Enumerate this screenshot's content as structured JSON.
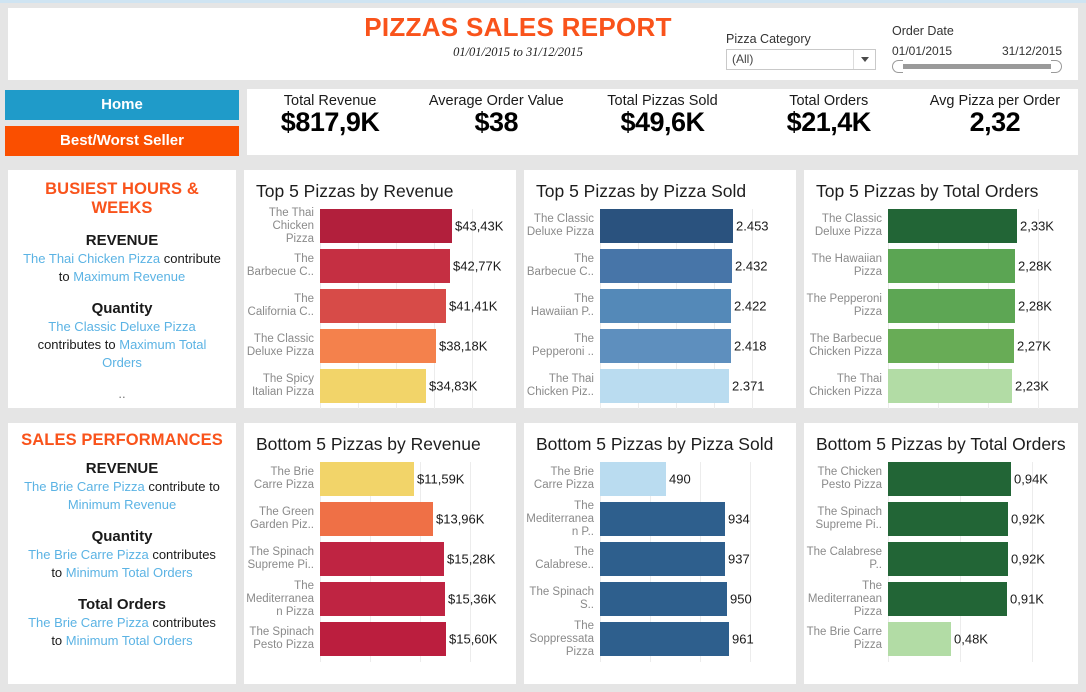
{
  "header": {
    "title": "PIZZAS SALES REPORT",
    "subtitle": "01/01/2015 to 31/12/2015",
    "category_label": "Pizza Category",
    "category_value": "(All)",
    "order_date_label": "Order Date",
    "date_start": "01/01/2015",
    "date_end": "31/12/2015"
  },
  "nav": {
    "home": "Home",
    "best_worst": "Best/Worst Seller",
    "home_color": "#1f9bc9",
    "best_color": "#fa4f00"
  },
  "kpis": [
    {
      "label": "Total Revenue",
      "value": "$817,9K"
    },
    {
      "label": "Average Order Value",
      "value": "$38"
    },
    {
      "label": "Total Pizzas Sold",
      "value": "$49,6K"
    },
    {
      "label": "Total Orders",
      "value": "$21,4K"
    },
    {
      "label": "Avg Pizza per Order",
      "value": "2,32"
    }
  ],
  "busiest": {
    "heading": "BUSIEST HOURS & WEEKS",
    "revenue_label": "REVENUE",
    "revenue_item": "The Thai Chicken Pizza",
    "revenue_mid": "contribute to ",
    "revenue_target": "Maximum Revenue",
    "quantity_label": "Quantity",
    "quantity_item": "The Classic Deluxe Pizza",
    "quantity_mid": "contributes to ",
    "quantity_target": "Maximum Total Orders",
    "dots": ".."
  },
  "sales": {
    "heading": "SALES PERFORMANCES",
    "revenue_label": "REVENUE",
    "revenue_item": "The Brie Carre Pizza",
    "revenue_mid": " contribute to ",
    "revenue_target": "Minimum Revenue",
    "quantity_label": "Quantity",
    "quantity_item": "The Brie Carre Pizza",
    "quantity_mid": " contributes to ",
    "quantity_target": "Minimum Total Orders",
    "orders_label": "Total Orders",
    "orders_item": "The Brie Carre Pizza",
    "orders_mid": " contributes to ",
    "orders_target": "Minimum Total Orders"
  },
  "chart_data": [
    {
      "id": "top_revenue",
      "type": "bar",
      "orientation": "horizontal",
      "title": "Top 5 Pizzas by Revenue",
      "xlabel": "",
      "ylabel": "",
      "grid": true,
      "xlim": [
        0,
        50000
      ],
      "categories": [
        "The Thai Chicken Pizza",
        "The Barbecue C..",
        "The California C..",
        "The Classic Deluxe Pizza",
        "The Spicy Italian Pizza"
      ],
      "values": [
        43430,
        42770,
        41410,
        38180,
        34830
      ],
      "labels": [
        "$43,43K",
        "$42,77K",
        "$41,41K",
        "$38,18K",
        "$34,83K"
      ],
      "colors": [
        "#b21f3c",
        "#c52f42",
        "#d74b48",
        "#f4814c",
        "#f2d469"
      ]
    },
    {
      "id": "top_sold",
      "type": "bar",
      "orientation": "horizontal",
      "title": "Top 5 Pizzas by  Pizza Sold",
      "xlabel": "",
      "ylabel": "",
      "grid": true,
      "xlim": [
        0,
        2800
      ],
      "categories": [
        "The Classic Deluxe Pizza",
        "The Barbecue C..",
        "The Hawaiian P..",
        "The Pepperoni ..",
        "The Thai Chicken Piz.."
      ],
      "values": [
        2453,
        2432,
        2422,
        2418,
        2371
      ],
      "labels": [
        "2.453",
        "2.432",
        "2.422",
        "2.418",
        "2.371"
      ],
      "colors": [
        "#2a527e",
        "#4775a8",
        "#5489b8",
        "#5e8fbe",
        "#badcf0"
      ]
    },
    {
      "id": "top_orders",
      "type": "bar",
      "orientation": "horizontal",
      "title": "Top 5 Pizzas by  Total Orders",
      "xlabel": "",
      "ylabel": "",
      "grid": true,
      "xlim": [
        0,
        2700
      ],
      "categories": [
        "The Classic Deluxe Pizza",
        "The Hawaiian Pizza",
        "The Pepperoni Pizza",
        "The Barbecue Chicken Pizza",
        "The Thai Chicken Pizza"
      ],
      "values": [
        2330,
        2280,
        2280,
        2270,
        2230
      ],
      "labels": [
        "2,33K",
        "2,28K",
        "2,28K",
        "2,27K",
        "2,23K"
      ],
      "colors": [
        "#226536",
        "#5ba553",
        "#5da654",
        "#68ac56",
        "#b2dca5"
      ]
    },
    {
      "id": "bottom_revenue",
      "type": "bar",
      "orientation": "horizontal",
      "title": "Bottom 5 Pizzas by Revenue",
      "xlabel": "",
      "ylabel": "",
      "grid": true,
      "xlim": [
        0,
        18500
      ],
      "categories": [
        "The Brie Carre Pizza",
        "The Green Garden Piz..",
        "The Spinach Supreme Pi..",
        "The Mediterranean Pizza",
        "The Spinach Pesto Pizza"
      ],
      "values": [
        11590,
        13960,
        15280,
        15360,
        15600
      ],
      "labels": [
        "$11,59K",
        "$13,96K",
        "$15,28K",
        "$15,36K",
        "$15,60K"
      ],
      "colors": [
        "#f2d469",
        "#ef7046",
        "#bf2442",
        "#bf2442",
        "#bb1e3e"
      ]
    },
    {
      "id": "bottom_sold",
      "type": "bar",
      "orientation": "horizontal",
      "title": "Bottom 5 Pizzas by  Pizza Sold",
      "xlabel": "",
      "ylabel": "",
      "grid": true,
      "xlim": [
        0,
        1120
      ],
      "categories": [
        "The Brie Carre Pizza",
        "The Mediterranean P..",
        "The Calabrese..",
        "The Spinach S..",
        "The Soppressata Pizza"
      ],
      "values": [
        490,
        934,
        937,
        950,
        961
      ],
      "labels": [
        "490",
        "934",
        "937",
        "950",
        "961"
      ],
      "colors": [
        "#badcf0",
        "#2e5f8d",
        "#2e5f8d",
        "#2e5f8d",
        "#2e5f8d"
      ]
    },
    {
      "id": "bottom_orders",
      "type": "bar",
      "orientation": "horizontal",
      "title": "Bottom 5 Pizzas by  Total Orders",
      "xlabel": "",
      "ylabel": "",
      "grid": true,
      "xlim": [
        0,
        1100
      ],
      "categories": [
        "The Chicken Pesto Pizza",
        "The Spinach Supreme Pi..",
        "The Calabrese P..",
        "The Mediterranean Pizza",
        "The Brie Carre Pizza"
      ],
      "values": [
        940,
        920,
        920,
        910,
        480
      ],
      "labels": [
        "0,94K",
        "0,92K",
        "0,92K",
        "0,91K",
        "0,48K"
      ],
      "colors": [
        "#226536",
        "#226536",
        "#226536",
        "#226536",
        "#b2dca5"
      ]
    }
  ]
}
